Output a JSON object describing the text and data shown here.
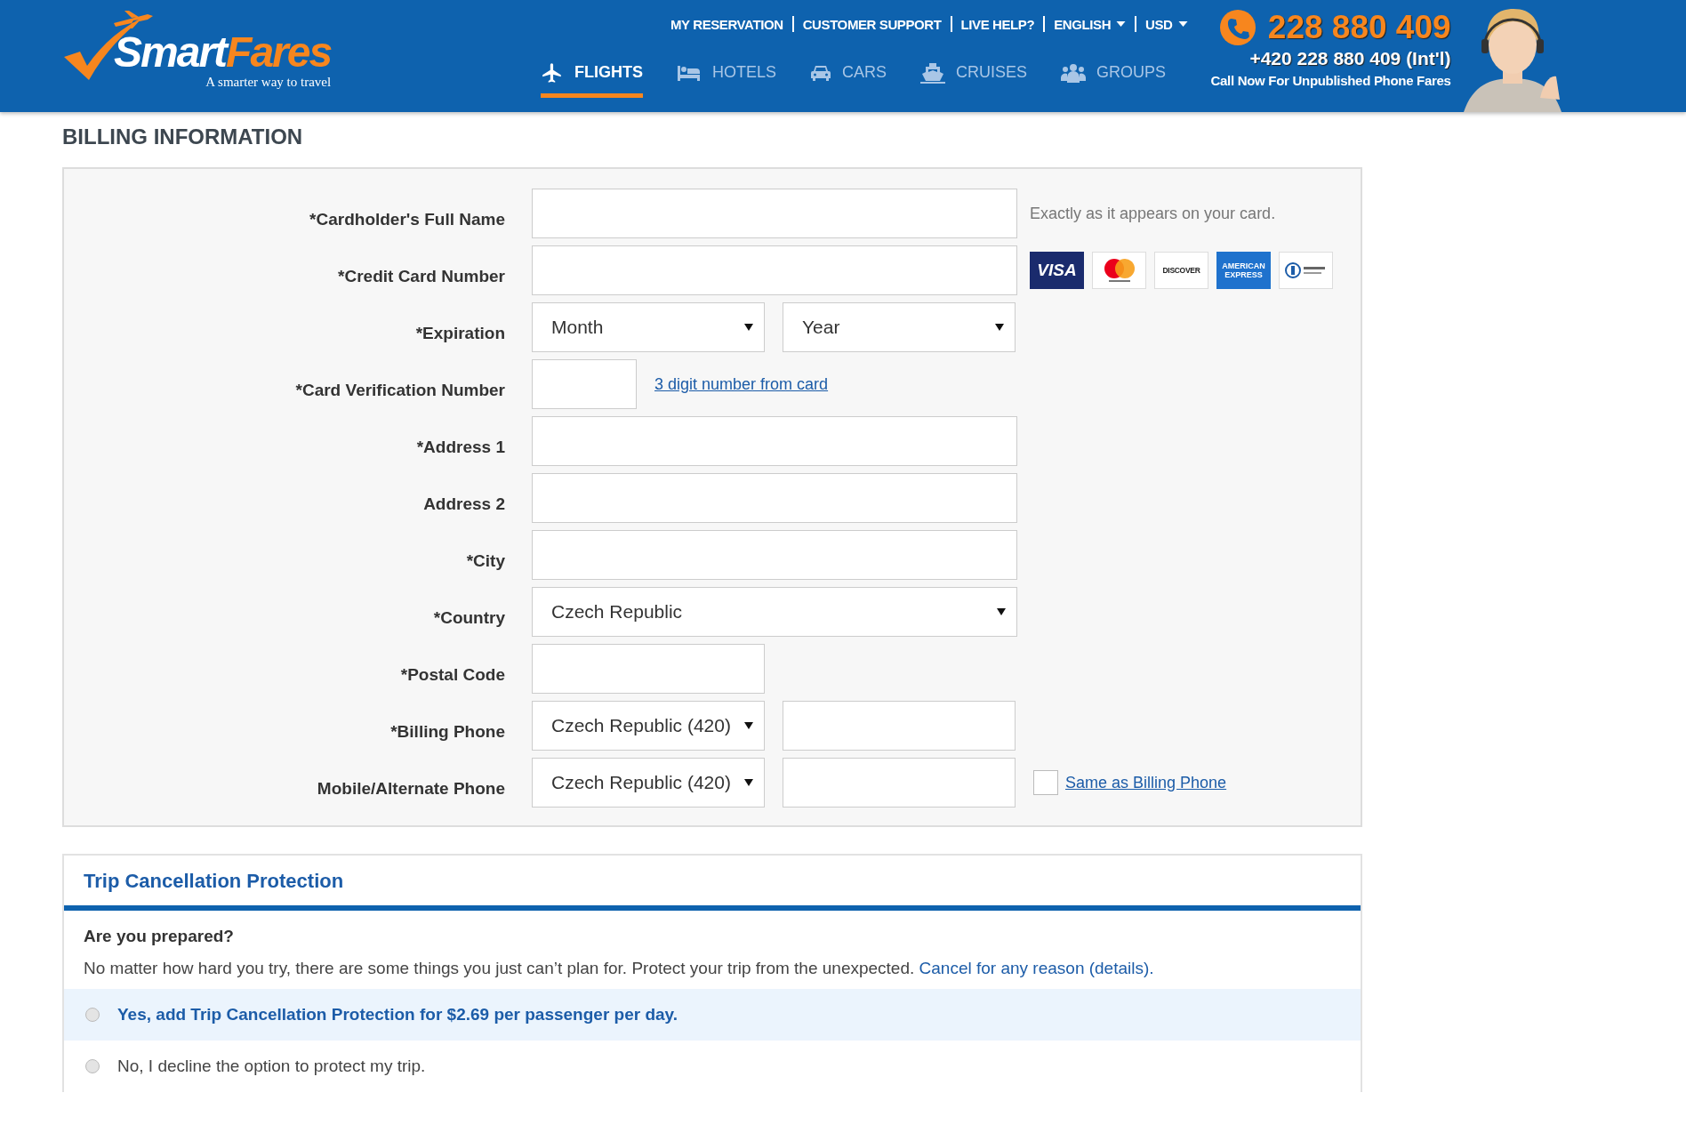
{
  "header": {
    "logo": {
      "name_a": "Smart",
      "name_b": "Fares",
      "tagline": "A smarter way to travel"
    },
    "top_links": [
      {
        "label": "MY RESERVATION",
        "dropdown": false
      },
      {
        "label": "CUSTOMER SUPPORT",
        "dropdown": false
      },
      {
        "label": "LIVE HELP?",
        "dropdown": false
      },
      {
        "label": "ENGLISH",
        "dropdown": true
      },
      {
        "label": "USD",
        "dropdown": true
      }
    ],
    "nav": [
      {
        "label": "FLIGHTS",
        "kind": "plane",
        "selected": true
      },
      {
        "label": "HOTELS",
        "kind": "bed",
        "selected": false
      },
      {
        "label": "CARS",
        "kind": "car",
        "selected": false
      },
      {
        "label": "CRUISES",
        "kind": "ship",
        "selected": false
      },
      {
        "label": "GROUPS",
        "kind": "people",
        "selected": false
      }
    ],
    "phone": {
      "number": "228 880 409",
      "intl": "+420 228 880 409 (Int'l)",
      "note": "Call Now For Unpublished Phone Fares"
    }
  },
  "billing": {
    "title": "BILLING INFORMATION",
    "rows": [
      {
        "label": "*Cardholder's Full Name",
        "fields": [
          {
            "kind": "input"
          }
        ],
        "hint": "Exactly as it appears on your card."
      },
      {
        "label": "*Credit Card Number",
        "fields": [
          {
            "kind": "input"
          }
        ],
        "cards": [
          {
            "kind": "visa",
            "label": "VISA"
          },
          {
            "kind": "mastercard"
          },
          {
            "kind": "discover",
            "label": "DISCOVER"
          },
          {
            "kind": "amex",
            "label": "AMERICAN EXPRESS"
          },
          {
            "kind": "diners"
          }
        ]
      },
      {
        "label": "*Expiration",
        "fields": [
          {
            "kind": "halfselect",
            "value": "Month"
          },
          {
            "kind": "halfselect",
            "value": "Year"
          }
        ]
      },
      {
        "label": "*Card Verification Number",
        "fields": [
          {
            "kind": "tinyinput"
          }
        ],
        "link": "3 digit number from card"
      },
      {
        "label": "*Address 1",
        "fields": [
          {
            "kind": "input"
          }
        ]
      },
      {
        "label": "Address 2",
        "fields": [
          {
            "kind": "input"
          }
        ]
      },
      {
        "label": "*City",
        "fields": [
          {
            "kind": "input"
          }
        ]
      },
      {
        "label": "*Country",
        "fields": [
          {
            "kind": "select",
            "value": "Czech Republic"
          }
        ]
      },
      {
        "label": "*Postal Code",
        "fields": [
          {
            "kind": "halfinput"
          }
        ]
      },
      {
        "label": "*Billing Phone",
        "fields": [
          {
            "kind": "halfselect",
            "value": "Czech Republic (420)"
          },
          {
            "kind": "halfinput"
          }
        ]
      },
      {
        "label": "Mobile/Alternate Phone",
        "fields": [
          {
            "kind": "halfselect",
            "value": "Czech Republic (420)"
          },
          {
            "kind": "halfinput"
          }
        ],
        "checkbox": {
          "label": "Same as Billing Phone",
          "checked": false
        }
      }
    ]
  },
  "trip": {
    "title": "Trip Cancellation Protection",
    "question": "Are you prepared?",
    "text": "No matter how hard you try, there are some things you just can’t plan for. Protect your trip from the unexpected.",
    "link": "Cancel for any reason (details).",
    "options": [
      {
        "label": "Yes, add Trip Cancellation Protection for $2.69 per passenger per day.",
        "selected": false,
        "highlighted": true
      },
      {
        "label": "No, I decline the option to protect my trip.",
        "selected": false,
        "highlighted": false
      }
    ]
  }
}
